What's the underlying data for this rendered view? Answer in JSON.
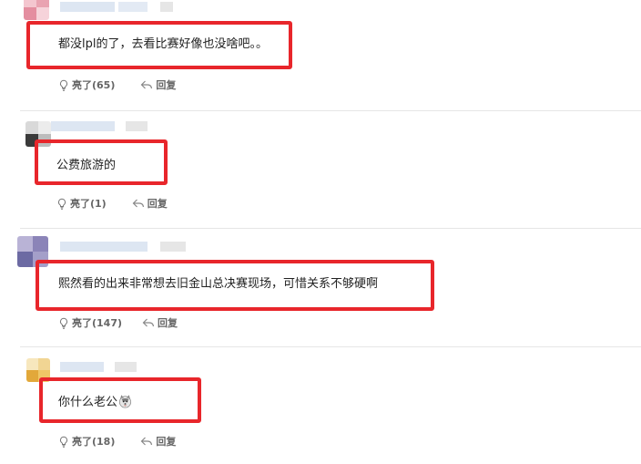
{
  "comments": [
    {
      "text": "都没lpl的了，去看比赛好像也没啥吧。。",
      "likes_label": "亮了(65)",
      "reply_label": "回复"
    },
    {
      "text": "公费旅游的",
      "likes_label": "亮了(1)",
      "reply_label": "回复"
    },
    {
      "text": "熙然看的出来非常想去旧金山总决赛现场，可惜关系不够硬啊",
      "likes_label": "亮了(147)",
      "reply_label": "回复"
    },
    {
      "text": "你什么老公",
      "likes_label": "亮了(18)",
      "reply_label": "回复"
    }
  ],
  "icons": {
    "like": "lightbulb-icon",
    "reply": "reply-arrow-icon",
    "emoji": "husky-dog-emoji-icon"
  },
  "colors": {
    "highlight_box": "#e8262b",
    "divider": "#e6e6e6",
    "action_text": "#666666"
  }
}
